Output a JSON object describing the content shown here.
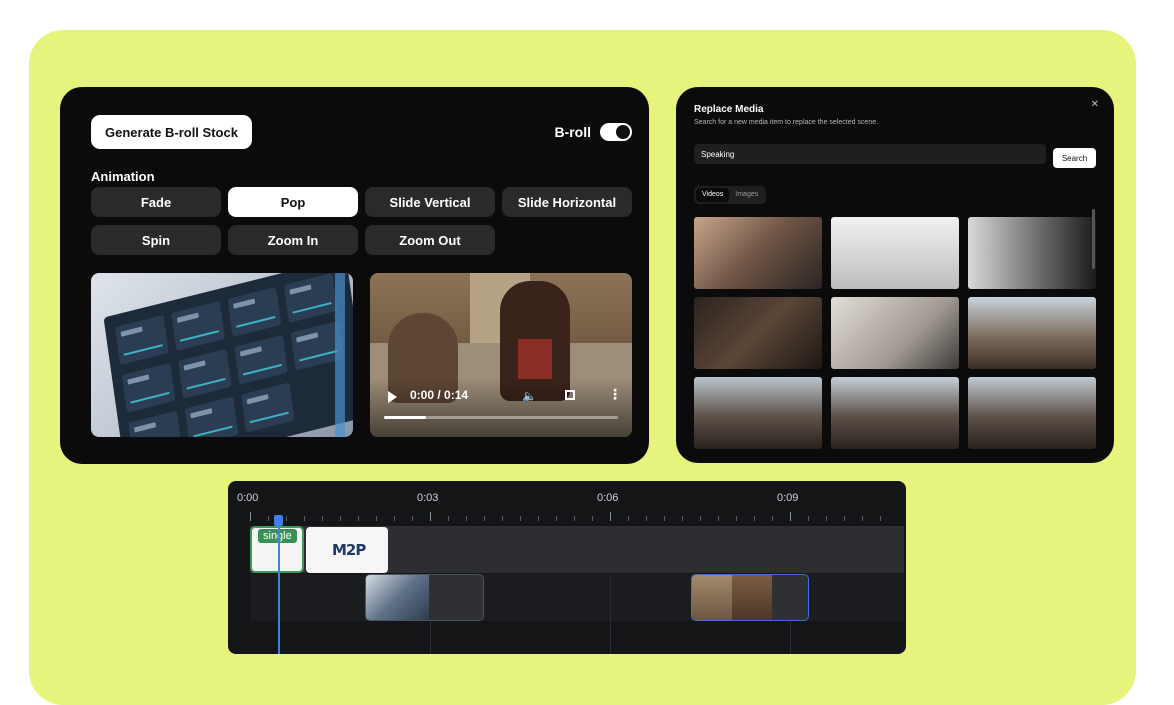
{
  "broll_panel": {
    "generate_label": "Generate B-roll Stock",
    "broll_label": "B-roll",
    "broll_enabled": true,
    "animation_label": "Animation",
    "animations": [
      "Fade",
      "Pop",
      "Slide Vertical",
      "Slide Horizontal",
      "Spin",
      "Zoom In",
      "Zoom Out"
    ],
    "selected_animation": "Pop",
    "video_time": "0:00 / 0:14",
    "video_progress": 0.18
  },
  "media_panel": {
    "title": "Replace Media",
    "subtitle": "Search for a new media item to replace the selected scene.",
    "search_value": "Speaking",
    "search_label": "Search",
    "tabs": [
      {
        "label": "Videos",
        "active": true
      },
      {
        "label": "Images",
        "active": false
      }
    ],
    "close_icon": "close-icon"
  },
  "timeline": {
    "ticks": [
      "0:00",
      "0:03",
      "0:06",
      "0:09"
    ],
    "clip_label": "single",
    "logo_text": "M2P"
  },
  "colors": {
    "background": "#e6f47e",
    "panel": "#0b0b0c",
    "accent_blue": "#3f7fe6",
    "accent_green": "#3a8f55"
  }
}
